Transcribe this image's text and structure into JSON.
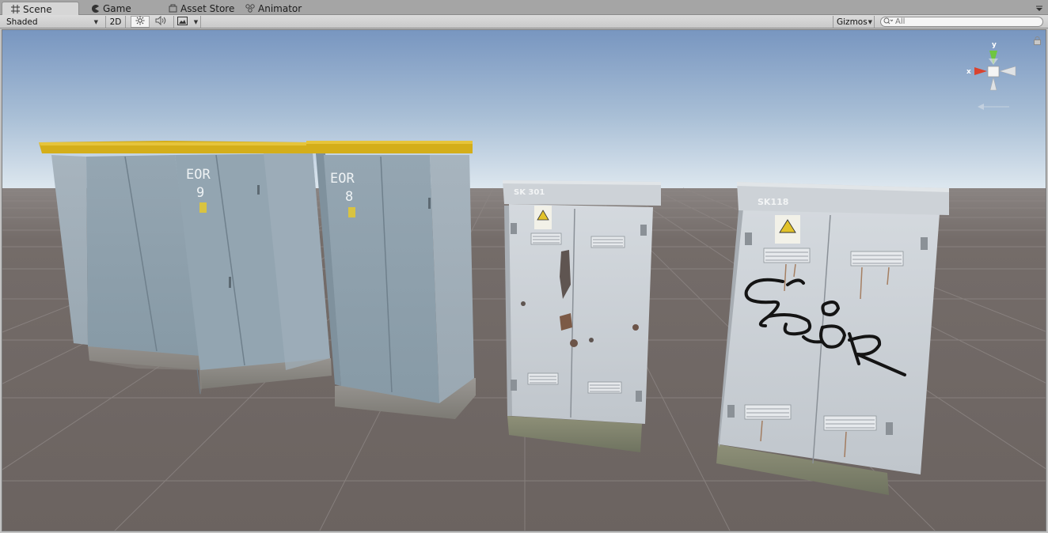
{
  "tabs": [
    {
      "label": "Scene",
      "icon": "scene-grid-icon",
      "active": true
    },
    {
      "label": "Game",
      "icon": "game-pacman-icon",
      "active": false
    },
    {
      "label": "Asset Store",
      "icon": "asset-store-icon",
      "active": false
    },
    {
      "label": "Animator",
      "icon": "animator-icon",
      "active": false
    }
  ],
  "toolbar": {
    "draw_mode": "Shaded",
    "mode_2d": "2D",
    "lighting_icon": "sun-icon",
    "audio_icon": "speaker-icon",
    "effects_icon": "image-icon",
    "gizmos_label": "Gizmos",
    "search_placeholder": "All"
  },
  "scene": {
    "orientation_axes": {
      "x": "x",
      "y": "y",
      "z": ""
    },
    "cabinets": [
      {
        "label_line1": "EOR",
        "label_line2": "9"
      },
      {
        "label_line1": "EOR",
        "label_line2": "8"
      },
      {
        "label_line1": "SK 301",
        "label_line2": ""
      },
      {
        "label_line1": "SK118",
        "label_line2": ""
      }
    ],
    "colors": {
      "sky_top": "#7d9cc4",
      "sky_horizon": "#dbe6ee",
      "ground": "#6d6561",
      "grid": "#8a8381",
      "cabinet_blue": "#8fa2b0",
      "roof_yellow": "#d9b318",
      "cabinet_white": "#c9ced4"
    }
  }
}
